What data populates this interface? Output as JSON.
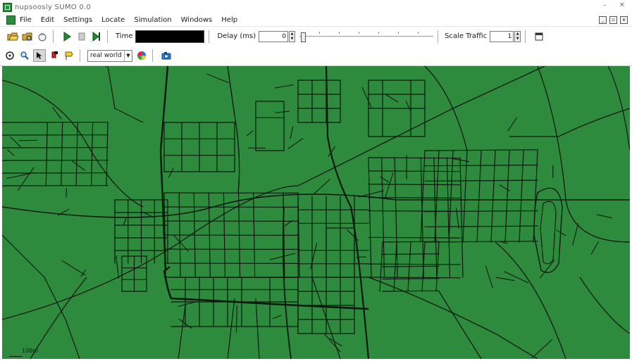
{
  "window": {
    "title": "nupsoosly SUMO 0.0",
    "minimize_glyph": "–",
    "close_glyph": "✕"
  },
  "menu": {
    "items": [
      {
        "label": "File"
      },
      {
        "label": "Edit"
      },
      {
        "label": "Settings"
      },
      {
        "label": "Locate"
      },
      {
        "label": "Simulation"
      },
      {
        "label": "Windows"
      },
      {
        "label": "Help"
      }
    ]
  },
  "mdi": {
    "minimize": "_",
    "restore": "▫",
    "close": "x"
  },
  "toolbar": {
    "time_label": "Time",
    "delay_label": "Delay (ms)",
    "delay_value": "0",
    "scale_label": "Scale Traffic",
    "scale_value": "1"
  },
  "viewbar": {
    "scheme_value": "real world"
  },
  "canvas": {
    "background": "#2e8b3e",
    "road_color": "#0b1a0d",
    "scale_label": "100m"
  }
}
